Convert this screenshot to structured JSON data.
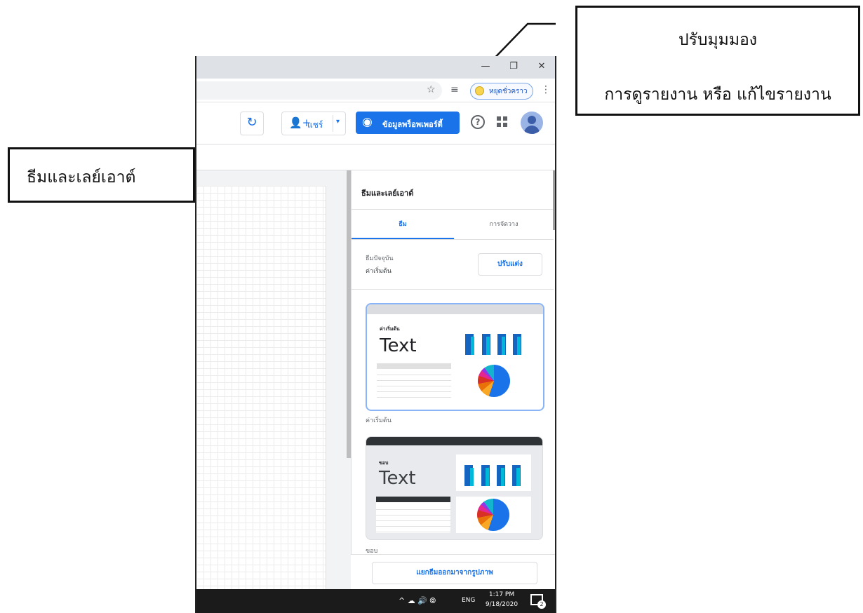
{
  "callouts": {
    "view_mode_title": "ปรับมุมมอง",
    "view_mode_desc": "การดูรายงาน หรือ แก้ไขรายงาน",
    "theme_layout": "ธีมและเลย์เอาต์"
  },
  "titlebar": {
    "minimize": "—",
    "restore": "❐",
    "close": "✕"
  },
  "toolbar": {
    "star_icon": "☆",
    "reading_list_icon": "≡",
    "pause_label": "หยุดชั่วคราว",
    "menu_icon": "⋮"
  },
  "appbar": {
    "refresh_icon": "↻",
    "share_icon": "👤+",
    "share_label": "แชร์",
    "share_dropdown": "▾",
    "view_icon": "◉",
    "view_label": "ข้อมูลพร็อพเพอร์ตี้",
    "help_icon": "?"
  },
  "panel": {
    "title": "ธีมและเลย์เอาต์",
    "tabs": [
      {
        "label": "ธีม",
        "active": true
      },
      {
        "label": "การจัดวาง",
        "active": false
      }
    ],
    "current_theme_label": "ธีมปัจจุบัน",
    "current_theme_value": "ค่าเริ่มต้น",
    "customize_button": "ปรับแต่ง",
    "themes": [
      {
        "preview_small": "ค่าเริ่มต้น",
        "preview_big": "Text",
        "label": "ค่าเริ่มต้น"
      },
      {
        "preview_small": "ขอบ",
        "preview_big": "Text",
        "label": "ขอบ"
      }
    ],
    "extract_button": "แยกธีมออกมาจากรูปภาพ"
  },
  "taskbar": {
    "tray_icons": "^ ☁ 🔊 ⦾",
    "language": "ENG",
    "time": "1:17 PM",
    "date": "9/18/2020",
    "notification_count": "2"
  },
  "colors": {
    "accent": "#1a73e8",
    "taskbar": "#1b1b1b",
    "titlebar": "#dee1e6"
  }
}
